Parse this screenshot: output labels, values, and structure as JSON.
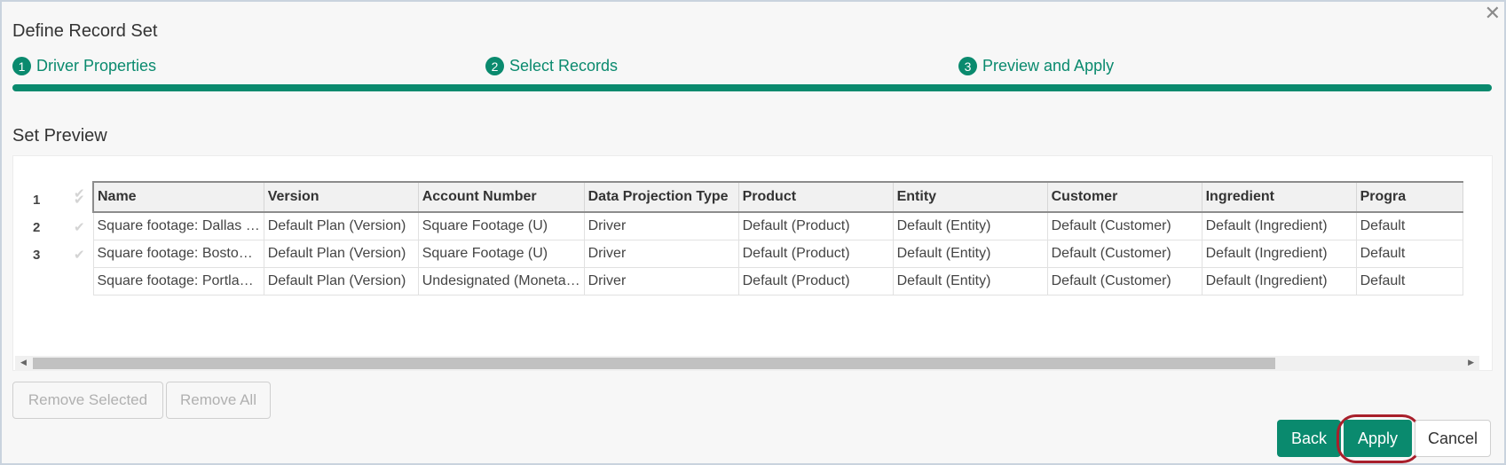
{
  "dialog": {
    "title": "Define Record Set",
    "close_icon": "✕"
  },
  "steps": [
    {
      "num": "1",
      "label": "Driver Properties"
    },
    {
      "num": "2",
      "label": "Select Records"
    },
    {
      "num": "3",
      "label": "Preview and Apply"
    }
  ],
  "section_title": "Set Preview",
  "grid": {
    "columns": [
      "Name",
      "Version",
      "Account Number",
      "Data Projection Type",
      "Product",
      "Entity",
      "Customer",
      "Ingredient",
      "Progra"
    ],
    "rows": [
      {
        "num": "1",
        "cells": [
          "Square footage: Dallas …",
          "Default Plan (Version)",
          "Square Footage (U)",
          "Driver",
          "Default (Product)",
          "Default (Entity)",
          "Default (Customer)",
          "Default (Ingredient)",
          "Default"
        ]
      },
      {
        "num": "2",
        "cells": [
          "Square footage: Bosto…",
          "Default Plan (Version)",
          "Square Footage (U)",
          "Driver",
          "Default (Product)",
          "Default (Entity)",
          "Default (Customer)",
          "Default (Ingredient)",
          "Default"
        ]
      },
      {
        "num": "3",
        "cells": [
          "Square footage: Portla…",
          "Default Plan (Version)",
          "Undesignated (Moneta…",
          "Driver",
          "Default (Product)",
          "Default (Entity)",
          "Default (Customer)",
          "Default (Ingredient)",
          "Default"
        ]
      }
    ]
  },
  "buttons": {
    "remove_selected": "Remove Selected",
    "remove_all": "Remove All",
    "back": "Back",
    "apply": "Apply",
    "cancel": "Cancel"
  },
  "colors": {
    "accent": "#0a8a6e",
    "highlight": "#a81f2b"
  }
}
